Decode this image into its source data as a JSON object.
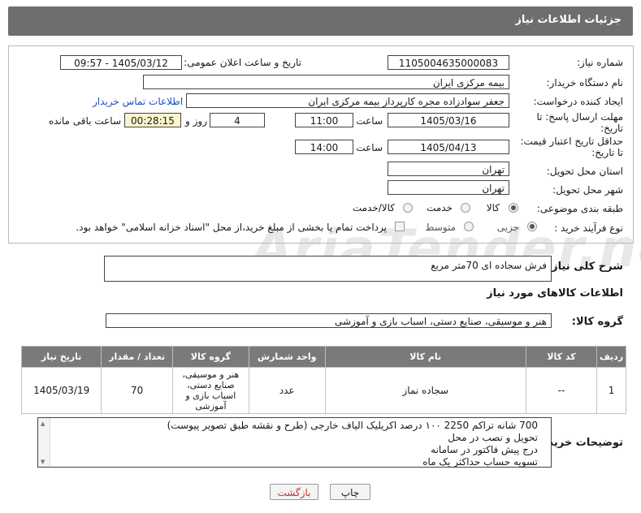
{
  "header": {
    "title": "جزئیات اطلاعات نیاز"
  },
  "fields": {
    "need_number_label": "شماره نیاز:",
    "need_number": "1105004635000083",
    "announce_label": "تاریخ و ساعت اعلان عمومی:",
    "announce_value": "1405/03/12 - 09:57",
    "buyer_org_label": "نام دستگاه خریدار:",
    "buyer_org": "بیمه مرکزی ایران",
    "creator_label": "ایجاد کننده درخواست:",
    "creator": "جعفر سوادزاده مجره کارپرداز بیمه مرکزی ایران",
    "contact_link": "اطلاعات تماس خریدار",
    "deadline_label_1": "مهلت ارسال پاسخ: تا",
    "deadline_label_2": "تاریخ:",
    "deadline_date": "1405/03/16",
    "time_label": "ساعت",
    "deadline_time": "11:00",
    "days_value": "4",
    "days_label": "روز و",
    "remaining_time": "00:28:15",
    "remaining_label": "ساعت باقی مانده",
    "validity_label_1": "حداقل تاریخ اعتبار قیمت:",
    "validity_label_2": "تا تاریخ:",
    "validity_date": "1405/04/13",
    "validity_time": "14:00",
    "province_label": "استان محل تحویل:",
    "province": "تهران",
    "city_label": "شهر محل تحویل:",
    "city": "تهران",
    "category_label": "طبقه بندی موضوعی:",
    "category_options": [
      "کالا",
      "خدمت",
      "کالا/خدمت"
    ],
    "process_label": "نوع فرآیند خرید :",
    "process_options": [
      "جزیی",
      "متوسط"
    ],
    "payment_note": "پرداخت تمام یا بخشی از مبلغ خرید،از محل \"اسناد خزانه اسلامی\" خواهد بود."
  },
  "description": {
    "label": "شرح کلی نیاز:",
    "value": "فرش سجاده ای 70متر مربع"
  },
  "goods_info": {
    "title": "اطلاعات کالاهای مورد نیاز",
    "group_label": "گروه کالا:",
    "group_value": "هنر و موسیقی، صنایع دستی، اسباب بازی و آموزشی"
  },
  "table": {
    "headers": [
      "ردیف",
      "کد کالا",
      "نام کالا",
      "واحد شمارش",
      "گروه کالا",
      "تعداد / مقدار",
      "تاریخ نیاز"
    ],
    "row": {
      "index": "1",
      "code": "--",
      "name": "سجاده نماز",
      "unit": "عدد",
      "group": "هنر و موسیقی، صنایع دستی، اسباب بازی و آموزشی",
      "qty": "70",
      "date": "1405/03/19"
    }
  },
  "buyer_notes": {
    "label": "توضیحات خریدار:",
    "lines": [
      "700 شانه تراکم 2250   ۱۰۰ درصد اکریلیک الیاف خارجی (طرح و نقشه طبق تصویر پیوست)",
      "تحویل و نصب در محل",
      "درج پیش فاکتور در سامانه",
      "تسویه حساب حداکثر یک ماه"
    ]
  },
  "buttons": {
    "print": "چاپ",
    "back": "بازگشت"
  },
  "watermark": "AriaTender.net",
  "colors": {
    "header_bg": "#6e6e6e",
    "remaining_bg": "#fbf5cc",
    "link": "#1c4fc4",
    "back_text": "#c0392b"
  }
}
